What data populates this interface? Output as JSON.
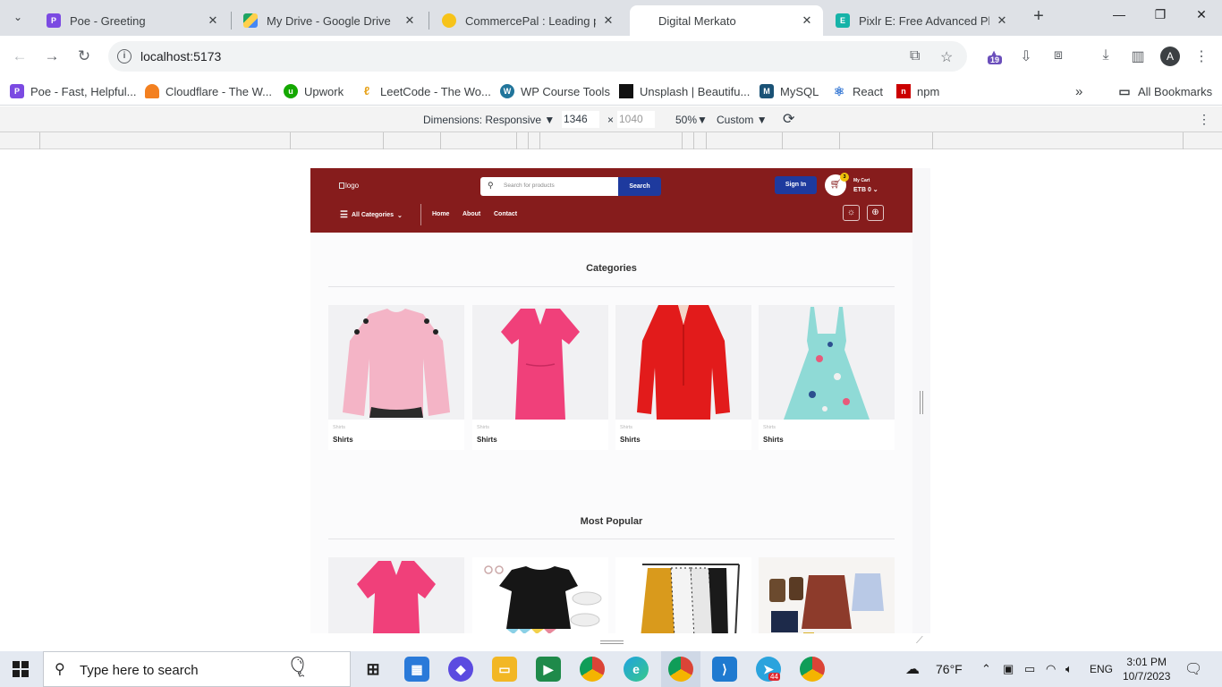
{
  "browser": {
    "tabs": [
      {
        "title": "Poe - Greeting",
        "active": false
      },
      {
        "title": "My Drive - Google Drive",
        "active": false
      },
      {
        "title": "CommercePal : Leading pla",
        "active": false
      },
      {
        "title": "Digital Merkato",
        "active": true
      },
      {
        "title": "Pixlr E: Free Advanced Phot",
        "active": false
      }
    ],
    "url": "localhost:5173",
    "profile_initial": "A",
    "extension_badge": "19",
    "bookmarks": [
      "Poe - Fast, Helpful...",
      "Cloudflare - The W...",
      "Upwork",
      "LeetCode - The Wo...",
      "WP Course Tools",
      "Unsplash | Beautifu...",
      "MySQL",
      "React",
      "npm"
    ],
    "all_bookmarks": "All Bookmarks",
    "overflow": "»"
  },
  "devtools": {
    "dimensions_label": "Dimensions: Responsive",
    "width": "1346",
    "times": "×",
    "height": "1040",
    "zoom": "50%",
    "throttle": "Custom"
  },
  "site": {
    "logo_alt": "logo",
    "search_placeholder": "Search for products",
    "search_button": "Search",
    "signin": "Sign In",
    "cart_count": "3",
    "cart_label": "My Cart",
    "cart_total": "ETB 0",
    "all_categories": "All Categories",
    "nav": [
      "Home",
      "About",
      "Contact"
    ],
    "categories_title": "Categories",
    "categories": [
      {
        "sub": "Shirts",
        "name": "Shirts"
      },
      {
        "sub": "Shirts",
        "name": "Shirts"
      },
      {
        "sub": "Shirts",
        "name": "Shirts"
      },
      {
        "sub": "Shirts",
        "name": "Shirts"
      }
    ],
    "popular_title": "Most Popular"
  },
  "taskbar": {
    "search_placeholder": "Type here to search",
    "weather": "76°F",
    "language": "ENG",
    "time": "3:01 PM",
    "date": "10/7/2023",
    "telegram_badge": "44"
  },
  "colors": {
    "header_bg": "#861c1c",
    "button_blue": "#1e3a9e",
    "cart_badge": "#f0c20a"
  }
}
